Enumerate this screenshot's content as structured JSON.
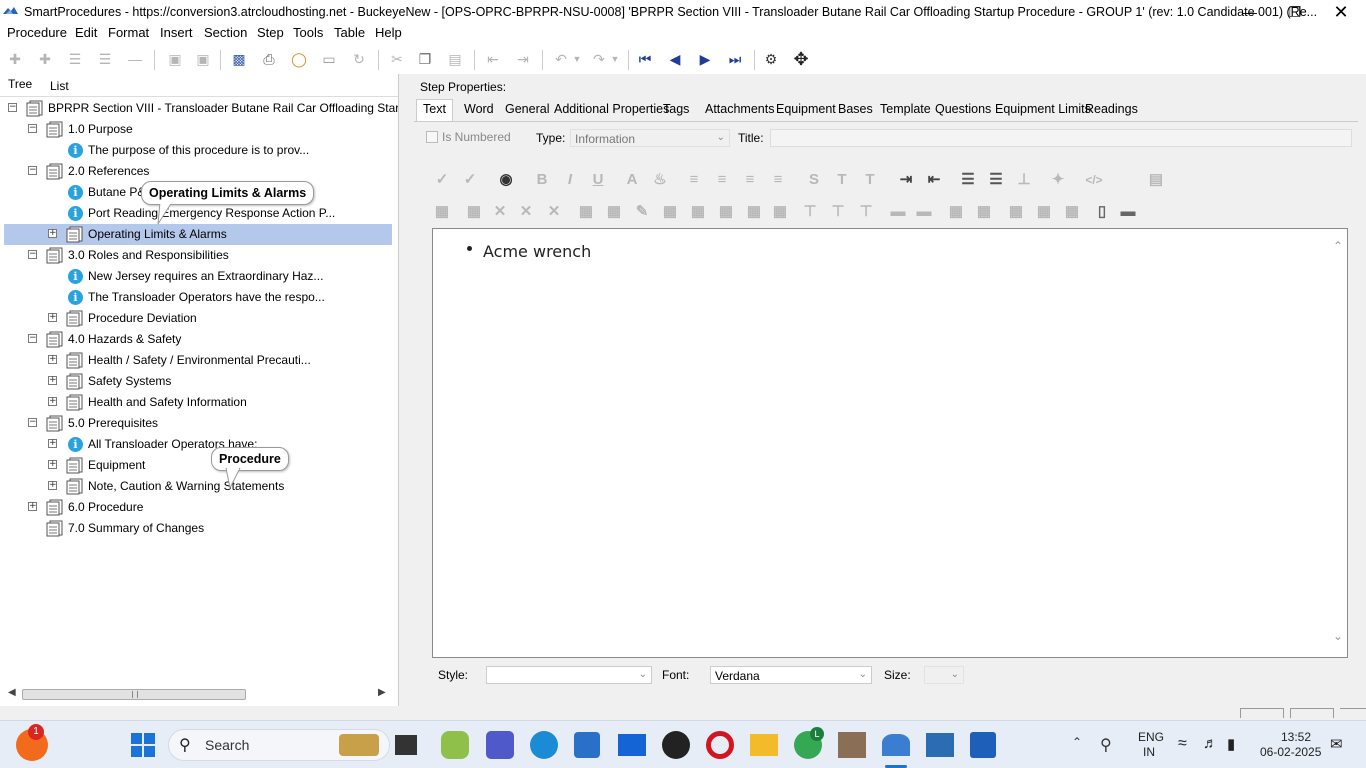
{
  "window": {
    "title": "SmartProcedures - https://conversion3.atrcloudhosting.net - BuckeyeNew - [OPS-OPRC-BPRPR-NSU-0008] 'BPRPR Section VIII - Transloader Butane Rail Car Offloading Startup Procedure - GROUP 1' (rev: 1.0 Candidate 001) (Re..."
  },
  "menu": [
    "Procedure",
    "Edit",
    "Format",
    "Insert",
    "Section",
    "Step",
    "Tools",
    "Table",
    "Help"
  ],
  "panel_tabs": [
    "Tree",
    "List"
  ],
  "tree": [
    {
      "label": "BPRPR Section VIII - Transloader Butane Rail Car Offloading Start...",
      "level": 0,
      "kind": "section",
      "exp": "-"
    },
    {
      "label": "1.0 Purpose",
      "level": 1,
      "kind": "section",
      "exp": "-"
    },
    {
      "label": "The purpose of this procedure is to prov...",
      "level": 2,
      "kind": "info",
      "exp": ""
    },
    {
      "label": "2.0 References",
      "level": 1,
      "kind": "section",
      "exp": "-"
    },
    {
      "label": "Butane P&IDs",
      "level": 2,
      "kind": "info",
      "exp": ""
    },
    {
      "label": "Port Reading Emergency Response Action P...",
      "level": 2,
      "kind": "info",
      "exp": ""
    },
    {
      "label": "Operating Limits & Alarms",
      "level": 2,
      "kind": "section",
      "exp": "+",
      "selected": true
    },
    {
      "label": "3.0 Roles and Responsibilities",
      "level": 1,
      "kind": "section",
      "exp": "-"
    },
    {
      "label": "New Jersey requires an Extraordinary Haz...",
      "level": 2,
      "kind": "info",
      "exp": ""
    },
    {
      "label": "The Transloader Operators have the respo...",
      "level": 2,
      "kind": "info",
      "exp": ""
    },
    {
      "label": "Procedure Deviation",
      "level": 2,
      "kind": "section",
      "exp": "+"
    },
    {
      "label": "4.0 Hazards & Safety",
      "level": 1,
      "kind": "section",
      "exp": "-"
    },
    {
      "label": "Health / Safety / Environmental Precauti...",
      "level": 2,
      "kind": "section",
      "exp": "+"
    },
    {
      "label": "Safety Systems",
      "level": 2,
      "kind": "section",
      "exp": "+"
    },
    {
      "label": "Health and Safety Information",
      "level": 2,
      "kind": "section",
      "exp": "+"
    },
    {
      "label": "5.0 Prerequisites",
      "level": 1,
      "kind": "section",
      "exp": "-"
    },
    {
      "label": "All Transloader Operators have:",
      "level": 2,
      "kind": "info",
      "exp": "+"
    },
    {
      "label": "Equipment",
      "level": 2,
      "kind": "section",
      "exp": "+"
    },
    {
      "label": "Note, Caution & Warning Statements",
      "level": 2,
      "kind": "section",
      "exp": "+"
    },
    {
      "label": "6.0 Procedure",
      "level": 1,
      "kind": "section",
      "exp": "+"
    },
    {
      "label": "7.0 Summary of Changes",
      "level": 1,
      "kind": "section",
      "exp": ""
    }
  ],
  "callouts": {
    "operating": "Operating Limits & Alarms",
    "procedure": "Procedure"
  },
  "step_properties": {
    "heading": "Step Properties:",
    "tabs": [
      "Text",
      "Word",
      "General",
      "Additional Properties",
      "Tags",
      "Attachments",
      "Equipment",
      "Bases",
      "Template",
      "Questions",
      "Equipment Limits",
      "Readings"
    ],
    "is_numbered_label": "Is Numbered",
    "type_label": "Type:",
    "type_value": "Information",
    "title_label": "Title:",
    "title_value": ""
  },
  "editor": {
    "bullet_text": "Acme wrench"
  },
  "bottom_bar": {
    "style_label": "Style:",
    "style_value": "",
    "font_label": "Font:",
    "font_value": "Verdana",
    "size_label": "Size:",
    "size_value": ""
  },
  "taskbar": {
    "search_label": "Search",
    "notification_badge": "1",
    "chrome_badge": "L",
    "lang_line1": "ENG",
    "lang_line2": "IN",
    "time": "13:52",
    "date": "06-02-2025"
  }
}
